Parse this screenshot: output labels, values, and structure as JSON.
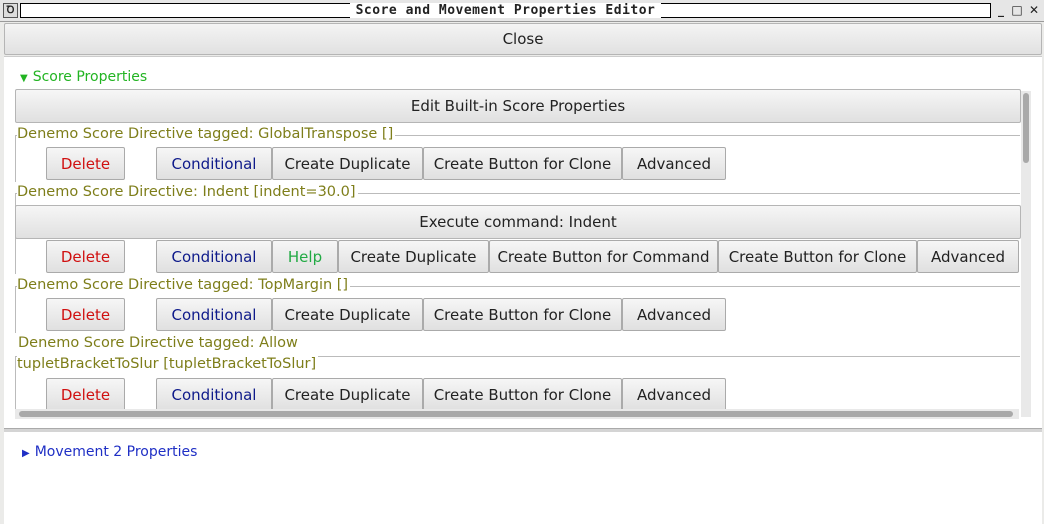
{
  "window": {
    "title": "Score and Movement Properties Editor",
    "icon_glyph": "Ꝺ",
    "minimize": "_",
    "maximize": "□",
    "close": "✕"
  },
  "close_button": "Close",
  "score_properties": {
    "expander_label": "Score Properties",
    "edit_builtin": "Edit Built-in Score Properties",
    "directives": [
      {
        "label": "Denemo Score  Directive tagged: GlobalTranspose []",
        "buttons": {
          "delete": "Delete",
          "conditional": "Conditional",
          "duplicate": "Create Duplicate",
          "clone": "Create Button for Clone",
          "advanced": "Advanced"
        }
      },
      {
        "label": "Denemo Score  Directive: Indent [indent=30.0]",
        "execute": "Execute command: Indent",
        "buttons": {
          "delete": "Delete",
          "conditional": "Conditional",
          "help": "Help",
          "duplicate": "Create Duplicate",
          "command": "Create Button for Command",
          "clone": "Create Button for Clone",
          "advanced": "Advanced"
        }
      },
      {
        "label": "Denemo Score  Directive tagged: TopMargin []",
        "buttons": {
          "delete": "Delete",
          "conditional": "Conditional",
          "duplicate": "Create Duplicate",
          "clone": "Create Button for Clone",
          "advanced": "Advanced"
        }
      },
      {
        "label": "Denemo Score  Directive tagged: Allow",
        "label_line2": "tupletBracketToSlur [tupletBracketToSlur]",
        "buttons": {
          "delete": "Delete",
          "conditional": "Conditional",
          "duplicate": "Create Duplicate",
          "clone": "Create Button for Clone",
          "advanced": "Advanced"
        }
      }
    ]
  },
  "movement_properties": {
    "expander_label": "Movement 2 Properties"
  },
  "colors": {
    "expander_open": "#22b422",
    "expander_closed": "#1f2fc5",
    "delete": "#d01010",
    "conditional": "#0e1a8a",
    "help": "#22aa44",
    "directive_label": "#7e7e1a"
  },
  "icons": {
    "expanded": "triangle-down-icon",
    "collapsed": "triangle-right-icon"
  }
}
